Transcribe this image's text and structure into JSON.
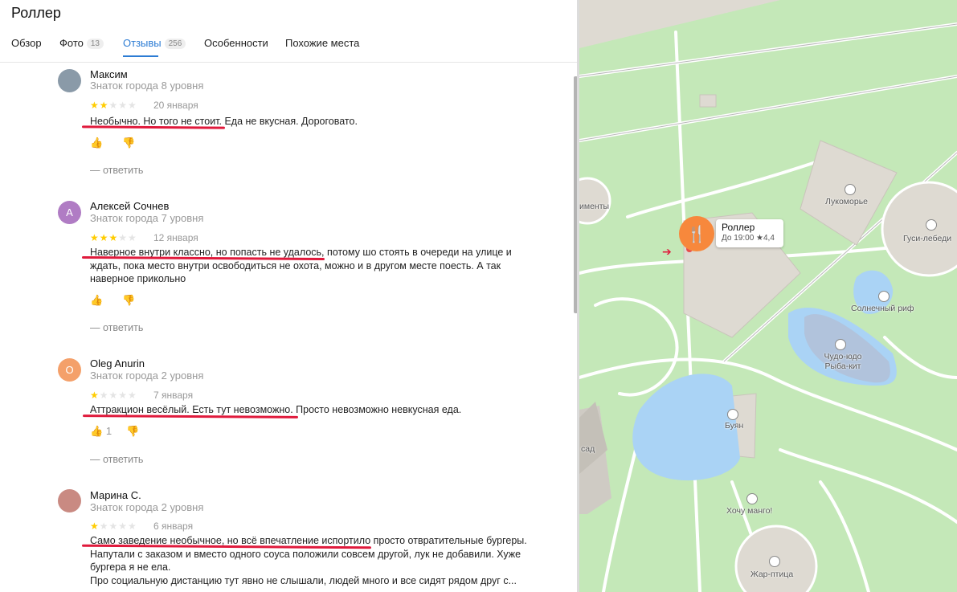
{
  "place_title": "Роллер",
  "tabs": [
    {
      "label": "Обзор",
      "count": ""
    },
    {
      "label": "Фото",
      "count": "13"
    },
    {
      "label": "Отзывы",
      "count": "256"
    },
    {
      "label": "Особенности",
      "count": ""
    },
    {
      "label": "Похожие места",
      "count": ""
    }
  ],
  "reviews": [
    {
      "name": "Максим",
      "level": "Знаток города 8 уровня",
      "rating": 2,
      "date": "20 января",
      "avatar_letter": "",
      "text": "Необычно. Но того не стоит. Еда не вкусная. Дороговато.",
      "likes": "",
      "reply": "— ответить"
    },
    {
      "name": "Алексей Сочнев",
      "level": "Знаток города 7 уровня",
      "rating": 3,
      "date": "12 января",
      "avatar_letter": "А",
      "text": "Наверное внутри классно, но попасть не удалось, потому шо стоять в очереди на улице и ждать, пока место внутри освободиться не охота, можно и в другом месте поесть. А так наверное прикольно",
      "likes": "",
      "reply": "— ответить"
    },
    {
      "name": "Oleg Anurin",
      "level": "Знаток города 2 уровня",
      "rating": 1,
      "date": "7 января",
      "avatar_letter": "O",
      "text": "Аттракцион весёлый. Есть тут невозможно. Просто невозможно невкусная еда.",
      "likes": "1",
      "reply": "— ответить"
    },
    {
      "name": "Марина С.",
      "level": "Знаток города 2 уровня",
      "rating": 1,
      "date": "6 января",
      "avatar_letter": "",
      "text": "Само заведение необычное, но всё впечатление испортило просто отвратительные бургеры. Напутали с заказом и вместо одного соуса положили совсем другой, лук не добавили. Хуже бургера я не ела.\nПро социальную дистанцию тут явно не слышали, людей много и все сидят рядом друг с...",
      "likes": "",
      "reply": ""
    }
  ],
  "map": {
    "pin_name": "Роллер",
    "pin_hours": "До 19:00",
    "pin_rating": "★4,4",
    "labels": [
      "Лукоморье",
      "Гуси-лебеди",
      "Солнечный риф",
      "Чудо-юдо Рыба-кит",
      "Буян",
      "Хочу манго!",
      "Жар-птица",
      "именты",
      "сад"
    ]
  },
  "colors": {
    "accent": "#2c7cd4",
    "star": "#ffcc00",
    "underline": "#e01a3c",
    "pin": "#f7883c",
    "park": "#c4e8b8",
    "water": "#aad3f5"
  }
}
